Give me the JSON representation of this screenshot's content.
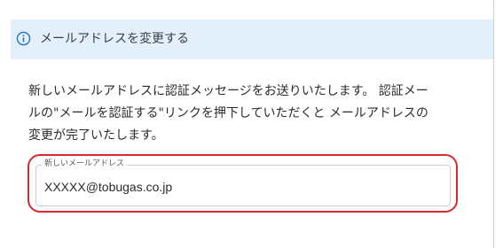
{
  "banner": {
    "title": "メールアドレスを変更する",
    "icon": "info-icon",
    "background": "#e3f0fb",
    "icon_color": "#1a73c9"
  },
  "description": {
    "line1": "新しいメールアドレスに認証メッセージをお送りいたします。 認証メー",
    "line2": "ルの\"メールを認証する\"リンクを押下していただくと メールアドレスの",
    "line3": "変更が完了いたします。"
  },
  "email_field": {
    "label": "新しいメールアドレス",
    "value": "XXXXX@tobugas.co.jp"
  },
  "highlight_color": "#d42a30"
}
